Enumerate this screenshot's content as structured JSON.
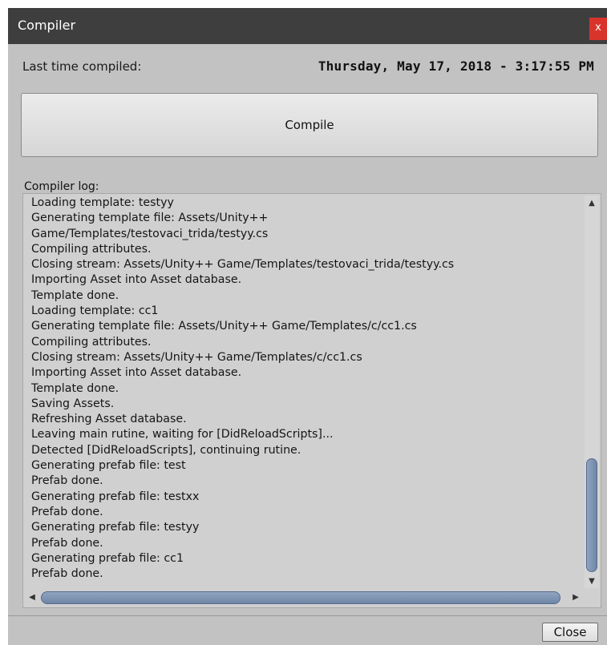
{
  "window": {
    "title": "Compiler",
    "close_glyph": "x"
  },
  "last_compiled": {
    "label": "Last time compiled:",
    "value": "Thursday, May 17, 2018 - 3:17:55 PM"
  },
  "compile_button": {
    "label": "Compile"
  },
  "log": {
    "label": "Compiler log:",
    "lines": [
      "Loading template: testyy",
      "Generating template file: Assets/Unity++",
      "Game/Templates/testovaci_trida/testyy.cs",
      "Compiling attributes.",
      "Closing stream: Assets/Unity++ Game/Templates/testovaci_trida/testyy.cs",
      "Importing Asset into Asset database.",
      "Template done.",
      "Loading template: cc1",
      "Generating template file: Assets/Unity++ Game/Templates/c/cc1.cs",
      "Compiling attributes.",
      "Closing stream: Assets/Unity++ Game/Templates/c/cc1.cs",
      "Importing Asset into Asset database.",
      "Template done.",
      "Saving Assets.",
      "Refreshing Asset database.",
      "Leaving main rutine, waiting for [DidReloadScripts]...",
      "Detected [DidReloadScripts], continuing rutine.",
      "Generating prefab file: test",
      "Prefab done.",
      "Generating prefab file: testxx",
      "Prefab done.",
      "Generating prefab file: testyy",
      "Prefab done.",
      "Generating prefab file: cc1",
      "Prefab done."
    ]
  },
  "close_button": {
    "label": "Close"
  },
  "icons": {
    "scroll_up": "up-arrow-icon",
    "scroll_down": "down-arrow-icon",
    "scroll_left": "left-arrow-icon",
    "scroll_right": "right-arrow-icon"
  },
  "colors": {
    "titlebar": "#3e3e3e",
    "close_x": "#d9342b",
    "scroll_thumb": "#7b90ae"
  }
}
